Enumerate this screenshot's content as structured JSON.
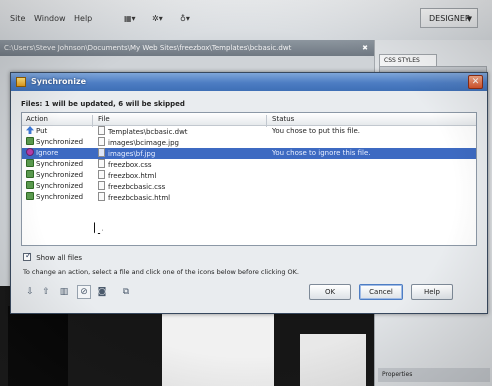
{
  "app": {
    "menu": [
      "Site",
      "Window",
      "Help"
    ],
    "toolbar_icons": [
      "layout-icon",
      "extensions-icon",
      "site-icon"
    ],
    "workspace_label": "DESIGNER",
    "doc_path": "C:\\Users\\Steve Johnson\\Documents\\My Web Sites\\freezbox\\Templates\\bcbasic.dwt",
    "panel_tab": "CSS STYLES",
    "panel_bottom_label": "Properties"
  },
  "dialog": {
    "title": "Synchronize",
    "summary": "Files: 1 will be updated, 6 will be skipped",
    "columns": {
      "action": "Action",
      "file": "File",
      "status": "Status"
    },
    "rows": [
      {
        "action": "Put",
        "icon": "put-arrow-icon",
        "file": "Templates\\bcbasic.dwt",
        "status": "You chose to put this file.",
        "selected": false
      },
      {
        "action": "Synchronized",
        "icon": "synchronized-icon",
        "file": "images\\bcimage.jpg",
        "status": "",
        "selected": false
      },
      {
        "action": "Ignore",
        "icon": "ignore-icon",
        "file": "images\\bf.jpg",
        "status": "You chose to ignore this file.",
        "selected": true
      },
      {
        "action": "Synchronized",
        "icon": "synchronized-icon",
        "file": "freezbox.css",
        "status": "",
        "selected": false
      },
      {
        "action": "Synchronized",
        "icon": "synchronized-icon",
        "file": "freezbox.html",
        "status": "",
        "selected": false
      },
      {
        "action": "Synchronized",
        "icon": "synchronized-icon",
        "file": "freezbcbasic.css",
        "status": "",
        "selected": false
      },
      {
        "action": "Synchronized",
        "icon": "synchronized-icon",
        "file": "freezbcbasic.html",
        "status": "",
        "selected": false
      }
    ],
    "show_all_label": "Show all files",
    "show_all_checked": true,
    "hint": "To change an action, select a file and click one of the icons below before clicking OK.",
    "tool_icons": [
      "get-icon",
      "put-icon",
      "delete-icon",
      "ignore-icon",
      "synchronized-icon",
      "compare-icon"
    ],
    "buttons": {
      "ok": "OK",
      "cancel": "Cancel",
      "help": "Help"
    }
  }
}
